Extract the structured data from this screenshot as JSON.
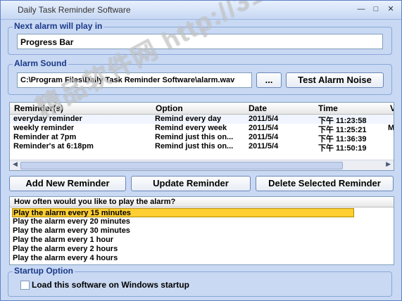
{
  "window": {
    "title": "Daily Task Reminder Software",
    "controls": {
      "minimize": "—",
      "maximize": "□",
      "close": "✕"
    }
  },
  "next_alarm": {
    "label": "Next alarm will play in",
    "value": "Progress Bar"
  },
  "alarm_sound": {
    "label": "Alarm Sound",
    "path": "C:\\Program Files\\Daily Task Reminder Software\\alarm.wav",
    "browse_label": "...",
    "test_label": "Test Alarm Noise"
  },
  "reminders": {
    "columns": [
      "Reminder(s)",
      "Option",
      "Date",
      "Time",
      "V"
    ],
    "rows": [
      [
        "everyday reminder",
        "Remind every day",
        "2011/5/4",
        "下午 11:23:58",
        ""
      ],
      [
        "weekly reminder",
        "Remind every week",
        "2011/5/4",
        "下午 11:25:21",
        "M"
      ],
      [
        "Reminder at 7pm",
        "Remind just this on...",
        "2011/5/4",
        "下午 11:36:39",
        ""
      ],
      [
        "Reminder's at 6:18pm",
        "Remind just this on...",
        "2011/5/4",
        "下午 11:50:19",
        ""
      ]
    ]
  },
  "actions": {
    "add": "Add New Reminder",
    "update": "Update Reminder",
    "delete": "Delete Selected Reminder"
  },
  "frequency": {
    "header": "How often would you like to play the alarm?",
    "options": [
      "Play the alarm every 15 minutes",
      "Play the alarm every 20 minutes",
      "Play the alarm every 30 minutes",
      "Play the alarm every 1 hour",
      "Play the alarm every 2 hours",
      "Play the alarm every 4 hours"
    ],
    "selected_index": 0
  },
  "startup": {
    "label": "Startup Option",
    "checkbox_label": "Load this software on Windows startup",
    "checked": false
  },
  "watermark": "精品软件网 http://31.to"
}
